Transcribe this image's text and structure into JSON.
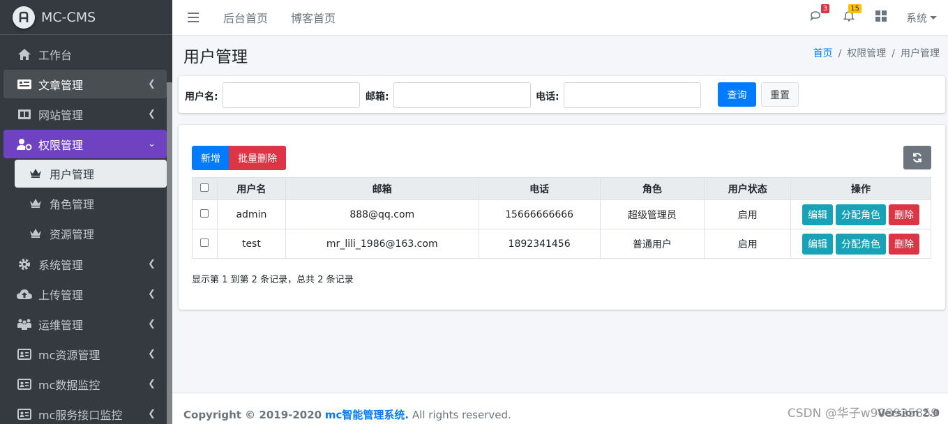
{
  "brand": {
    "name": "MC-CMS",
    "logo": "Ai"
  },
  "sidebar": {
    "items": [
      {
        "label": "工作台",
        "icon": "home-icon"
      },
      {
        "label": "文章管理",
        "icon": "article-icon"
      },
      {
        "label": "网站管理",
        "icon": "columns-icon"
      },
      {
        "label": "权限管理",
        "icon": "user-cog-icon"
      },
      {
        "label": "系统管理",
        "icon": "gear-icon"
      },
      {
        "label": "上传管理",
        "icon": "cloud-upload-icon"
      },
      {
        "label": "运维管理",
        "icon": "people-icon"
      },
      {
        "label": "mc资源管理",
        "icon": "id-card-icon"
      },
      {
        "label": "mc数据监控",
        "icon": "id-card-icon"
      },
      {
        "label": "mc服务接口监控",
        "icon": "id-card-icon"
      }
    ],
    "sub_items": [
      {
        "label": "用户管理",
        "icon": "crown-icon"
      },
      {
        "label": "角色管理",
        "icon": "crown-icon"
      },
      {
        "label": "资源管理",
        "icon": "crown-icon"
      }
    ]
  },
  "topnav": {
    "links": [
      "后台首页",
      "博客首页"
    ],
    "messages_count": "3",
    "notifications_count": "15",
    "system_label": "系统"
  },
  "page": {
    "title": "用户管理"
  },
  "breadcrumb": {
    "home": "首页",
    "parent": "权限管理",
    "current": "用户管理",
    "sep": "/"
  },
  "search": {
    "username_label": "用户名:",
    "email_label": "邮箱:",
    "phone_label": "电话:",
    "username_value": "",
    "email_value": "",
    "phone_value": "",
    "query_label": "查询",
    "reset_label": "重置"
  },
  "toolbar": {
    "add_label": "新增",
    "batch_delete_label": "批量删除"
  },
  "table": {
    "columns": [
      "用户名",
      "邮箱",
      "电话",
      "角色",
      "用户状态",
      "操作"
    ],
    "rows": [
      {
        "username": "admin",
        "email": "888@qq.com",
        "phone": "15666666666",
        "role": "超级管理员",
        "status": "启用"
      },
      {
        "username": "test",
        "email": "mr_lili_1986@163.com",
        "phone": "1892341456",
        "role": "普通用户",
        "status": "启用"
      }
    ],
    "actions": {
      "edit": "编辑",
      "assign_role": "分配角色",
      "delete": "删除"
    },
    "summary": "显示第 1 到第 2 条记录，总共 2 条记录"
  },
  "footer": {
    "copyright_prefix": "Copyright © 2019-2020",
    "system_name": "mc智能管理系统.",
    "rights": "All rights reserved.",
    "version": "Version 2.0"
  },
  "watermark": "CSDN @华子w908925859",
  "colors": {
    "sidebar_bg": "#343a40",
    "active_menu": "#6f42c1",
    "primary": "#007bff",
    "danger": "#dc3545",
    "info": "#17a2b8"
  }
}
